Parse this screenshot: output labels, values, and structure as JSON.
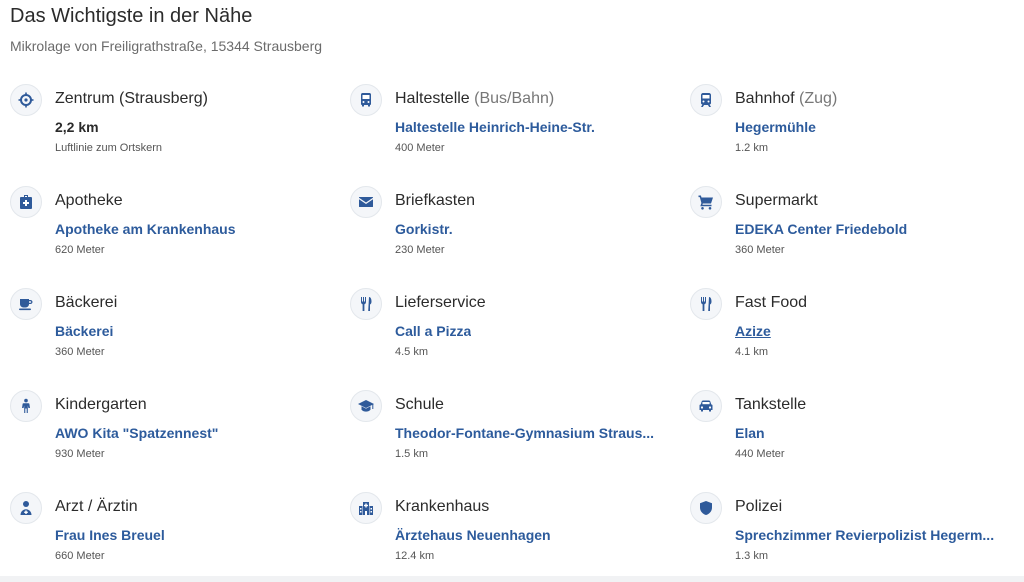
{
  "header": {
    "title": "Das Wichtigste in der Nähe",
    "subtitle": "Mikrolage von Freiligrathstraße, 15344 Strausberg"
  },
  "items": [
    {
      "icon": "crosshair-icon",
      "category": "Zentrum (Strausberg)",
      "qualifier": "",
      "name": "2,2 km",
      "distance": "Luftlinie zum Ortskern",
      "link": false
    },
    {
      "icon": "bus-icon",
      "category": "Haltestelle",
      "qualifier": "(Bus/Bahn)",
      "name": "Haltestelle Heinrich-Heine-Str.",
      "distance": "400 Meter",
      "link": true
    },
    {
      "icon": "train-icon",
      "category": "Bahnhof",
      "qualifier": "(Zug)",
      "name": "Hegermühle",
      "distance": "1.2 km",
      "link": true
    },
    {
      "icon": "pharmacy-icon",
      "category": "Apotheke",
      "qualifier": "",
      "name": "Apotheke am Krankenhaus",
      "distance": "620 Meter",
      "link": true
    },
    {
      "icon": "mail-icon",
      "category": "Briefkasten",
      "qualifier": "",
      "name": "Gorkistr.",
      "distance": "230 Meter",
      "link": true
    },
    {
      "icon": "cart-icon",
      "category": "Supermarkt",
      "qualifier": "",
      "name": "EDEKA Center Friedebold",
      "distance": "360 Meter",
      "link": true
    },
    {
      "icon": "cup-icon",
      "category": "Bäckerei",
      "qualifier": "",
      "name": "Bäckerei",
      "distance": "360 Meter",
      "link": true
    },
    {
      "icon": "cutlery-icon",
      "category": "Lieferservice",
      "qualifier": "",
      "name": "Call a Pizza",
      "distance": "4.5 km",
      "link": true
    },
    {
      "icon": "cutlery-icon",
      "category": "Fast Food",
      "qualifier": "",
      "name": "Azize",
      "distance": "4.1 km",
      "link": true,
      "hover": true
    },
    {
      "icon": "child-icon",
      "category": "Kindergarten",
      "qualifier": "",
      "name": "AWO Kita \"Spatzennest\"",
      "distance": "930 Meter",
      "link": true
    },
    {
      "icon": "graduation-cap-icon",
      "category": "Schule",
      "qualifier": "",
      "name": "Theodor-Fontane-Gymnasium Straus...",
      "distance": "1.5 km",
      "link": true
    },
    {
      "icon": "car-icon",
      "category": "Tankstelle",
      "qualifier": "",
      "name": "Elan",
      "distance": "440 Meter",
      "link": true
    },
    {
      "icon": "doctor-icon",
      "category": "Arzt / Ärztin",
      "qualifier": "",
      "name": "Frau Ines Breuel",
      "distance": "660 Meter",
      "link": true
    },
    {
      "icon": "hospital-icon",
      "category": "Krankenhaus",
      "qualifier": "",
      "name": "Ärztehaus Neuenhagen",
      "distance": "12.4 km",
      "link": true
    },
    {
      "icon": "shield-icon",
      "category": "Polizei",
      "qualifier": "",
      "name": "Sprechzimmer Revierpolizist Hegerm...",
      "distance": "1.3 km",
      "link": true
    }
  ],
  "colors": {
    "accent": "#2d5b9c",
    "icon": "#2f5a9a"
  }
}
